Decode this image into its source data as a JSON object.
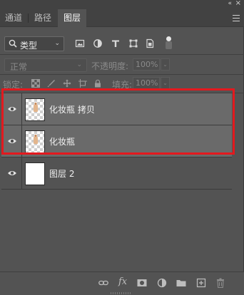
{
  "panel": {
    "collapse_glyph": "«",
    "close_glyph": "×",
    "tabs": [
      {
        "label": "通道",
        "active": false
      },
      {
        "label": "路径",
        "active": false
      },
      {
        "label": "图层",
        "active": true
      }
    ],
    "menu_icon": "panel-menu-icon"
  },
  "filter": {
    "kind_label": "类型",
    "icons": [
      "pixel-filter-icon",
      "adjustment-filter-icon",
      "type-filter-icon",
      "shape-filter-icon",
      "smartobject-filter-icon"
    ]
  },
  "blend": {
    "mode": "正常",
    "opacity_label": "不透明度:",
    "opacity_value": "100%"
  },
  "lock": {
    "label": "锁定:",
    "icons": [
      "lock-transparent-icon",
      "lock-image-icon",
      "lock-position-icon",
      "lock-artboard-icon",
      "lock-all-icon"
    ],
    "fill_label": "填充:",
    "fill_value": "100%"
  },
  "layers": [
    {
      "name": "化妆瓶 拷贝",
      "visible": true,
      "thumb": "checker",
      "selected": true
    },
    {
      "name": "化妆瓶",
      "visible": true,
      "thumb": "checker",
      "selected": true
    },
    {
      "name": "图层 2",
      "visible": true,
      "thumb": "white",
      "selected": false
    }
  ],
  "bottom_icons": [
    "link-layers-icon",
    "fx-icon",
    "add-mask-icon",
    "adjustment-layer-icon",
    "new-group-icon",
    "new-layer-icon",
    "delete-layer-icon"
  ],
  "bottom_fx_label": "fx",
  "colors": {
    "panel_bg": "#535353",
    "tab_bg": "#424242",
    "selected_row": "#6a6a6a",
    "highlight": "#e3191e"
  }
}
